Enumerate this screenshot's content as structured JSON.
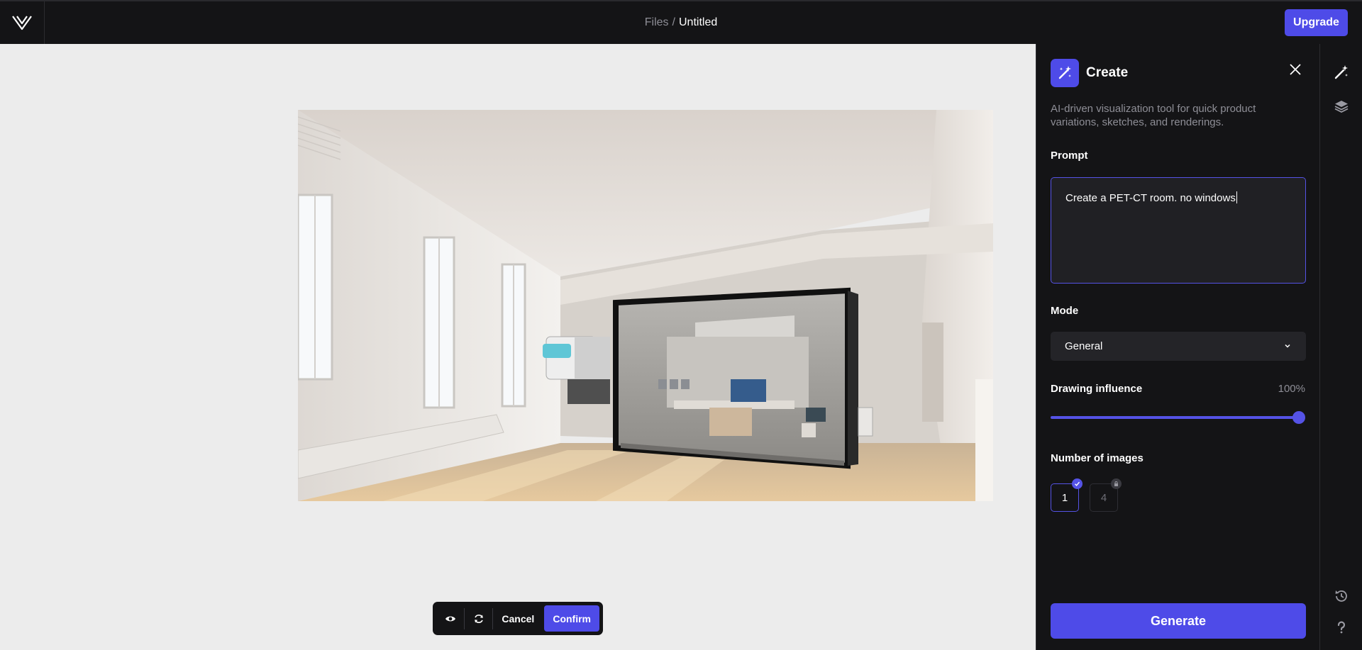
{
  "header": {
    "breadcrumb_root": "Files",
    "breadcrumb_separator": "/",
    "breadcrumb_current": "Untitled",
    "upgrade_label": "Upgrade"
  },
  "toolbar": {
    "cancel_label": "Cancel",
    "confirm_label": "Confirm",
    "icons": [
      "eye-icon",
      "refresh-icon"
    ]
  },
  "panel": {
    "title": "Create",
    "description": "AI-driven visualization tool for quick product variations, sketches, and renderings.",
    "prompt_label": "Prompt",
    "prompt_value": "Create a PET-CT room. no windows",
    "mode_label": "Mode",
    "mode_value": "General",
    "influence_label": "Drawing influence",
    "influence_value": "100%",
    "influence_percent": 100,
    "images_label": "Number of images",
    "image_options": [
      {
        "value": "1",
        "selected": true,
        "locked": false
      },
      {
        "value": "4",
        "selected": false,
        "locked": true
      }
    ],
    "generate_label": "Generate"
  },
  "rail": {
    "icons": [
      "magic-wand-icon",
      "layers-icon",
      "history-icon",
      "help-icon"
    ]
  },
  "colors": {
    "accent": "#4e4be8",
    "topbar_bg": "#141416",
    "canvas_bg": "#ececec",
    "panel_bg": "#141416"
  }
}
